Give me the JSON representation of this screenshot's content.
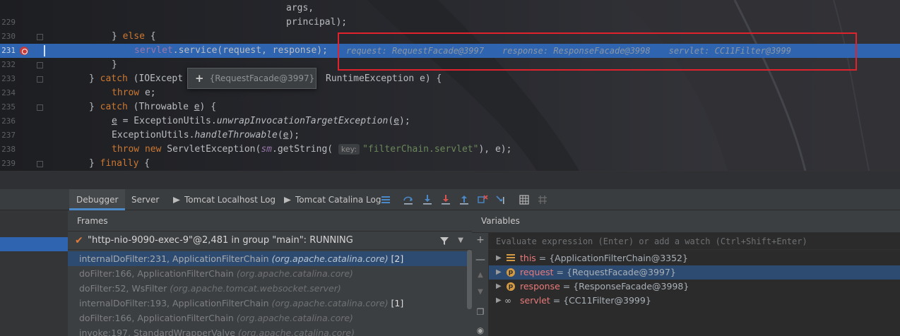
{
  "editor": {
    "lines": [
      {
        "num": "",
        "parts": [
          {
            "t": "args,",
            "c": ""
          }
        ]
      },
      {
        "num": "229",
        "parts": [
          {
            "t": "principal);",
            "c": ""
          }
        ]
      },
      {
        "num": "230",
        "parts": [
          {
            "t": "} ",
            "c": ""
          },
          {
            "t": "else",
            "c": "kw"
          },
          {
            "t": " {",
            "c": ""
          }
        ]
      },
      {
        "num": "231",
        "parts": [
          {
            "t": "servlet",
            "c": "fld"
          },
          {
            "t": ".service(request, response);",
            "c": ""
          }
        ]
      },
      {
        "num": "232",
        "parts": [
          {
            "t": "}",
            "c": ""
          }
        ]
      },
      {
        "num": "233",
        "parts": [
          {
            "t": "} ",
            "c": ""
          },
          {
            "t": "catch",
            "c": "kw"
          },
          {
            "t": " (IOExcept",
            "c": ""
          }
        ]
      },
      {
        "num": "234",
        "parts": [
          {
            "t": "throw",
            "c": "kw"
          },
          {
            "t": " e;",
            "c": ""
          }
        ]
      },
      {
        "num": "235",
        "parts": [
          {
            "t": "} ",
            "c": ""
          },
          {
            "t": "catch",
            "c": "kw"
          },
          {
            "t": " (Throwable ",
            "c": ""
          },
          {
            "t": "e",
            "c": "ul"
          },
          {
            "t": ") {",
            "c": ""
          }
        ]
      },
      {
        "num": "236",
        "parts": [
          {
            "t": "e",
            "c": "ul"
          },
          {
            "t": " = ExceptionUtils.",
            "c": ""
          },
          {
            "t": "unwrapInvocationTargetException",
            "c": "it"
          },
          {
            "t": "(",
            "c": ""
          },
          {
            "t": "e",
            "c": "ul"
          },
          {
            "t": ");",
            "c": ""
          }
        ]
      },
      {
        "num": "237",
        "parts": [
          {
            "t": "ExceptionUtils.",
            "c": ""
          },
          {
            "t": "handleThrowable",
            "c": "it"
          },
          {
            "t": "(",
            "c": ""
          },
          {
            "t": "e",
            "c": "ul"
          },
          {
            "t": ");",
            "c": ""
          }
        ]
      },
      {
        "num": "238",
        "parts": [
          {
            "t": "throw",
            "c": "kw"
          },
          {
            "t": " ",
            "c": ""
          },
          {
            "t": "new",
            "c": "kw"
          },
          {
            "t": " ServletException(",
            "c": ""
          },
          {
            "t": "sm",
            "c": "fld it"
          },
          {
            "t": ".getString(",
            "c": ""
          }
        ]
      },
      {
        "num": "239",
        "parts": [
          {
            "t": "} ",
            "c": ""
          },
          {
            "t": "finally",
            "c": "kw"
          },
          {
            "t": " {",
            "c": ""
          }
        ]
      }
    ],
    "line233_tail": "RuntimeException e) {",
    "line238_key_hint": "key:",
    "line238_tail_str": "\"filterChain.servlet\"",
    "line238_tail": "), e);",
    "inline_values": {
      "request": "request: RequestFacade@3997",
      "response": "response: ResponseFacade@3998",
      "servlet": "servlet: CC11Filter@3999"
    },
    "popup": {
      "plus": "+",
      "value": "{RequestFacade@3997}"
    }
  },
  "tabs": [
    {
      "label": "Debugger",
      "active": true
    },
    {
      "label": "Server",
      "active": false
    },
    {
      "label": "Tomcat Localhost Log",
      "active": false,
      "icon": "terminal-icon"
    },
    {
      "label": "Tomcat Catalina Log",
      "active": false,
      "icon": "terminal-icon"
    }
  ],
  "frames": {
    "title": "Frames",
    "thread": "\"http-nio-9090-exec-9\"@2,481 in group \"main\": RUNNING",
    "items": [
      {
        "method": "internalDoFilter:231, ApplicationFilterChain ",
        "pkg": "(org.apache.catalina.core)",
        "count": " [2]",
        "selected": true
      },
      {
        "method": "doFilter:166, ApplicationFilterChain ",
        "pkg": "(org.apache.catalina.core)",
        "count": ""
      },
      {
        "method": "doFilter:52, WsFilter ",
        "pkg": "(org.apache.tomcat.websocket.server)",
        "count": ""
      },
      {
        "method": "internalDoFilter:193, ApplicationFilterChain ",
        "pkg": "(org.apache.catalina.core)",
        "count": " [1]"
      },
      {
        "method": "doFilter:166, ApplicationFilterChain ",
        "pkg": "(org.apache.catalina.core)",
        "count": ""
      },
      {
        "method": "invoke:197, StandardWrapperValve ",
        "pkg": "(org.apache.catalina.core)",
        "count": ""
      }
    ]
  },
  "variables": {
    "title": "Variables",
    "eval_placeholder": "Evaluate expression (Enter) or add a watch (Ctrl+Shift+Enter)",
    "items": [
      {
        "name": "this",
        "value": " = {ApplicationFilterChain@3352}",
        "icon": "field-lines-icon"
      },
      {
        "name": "request",
        "value": " = {RequestFacade@3997}",
        "icon": "parameter-icon",
        "selected": true
      },
      {
        "name": "response",
        "value": " = {ResponseFacade@3998}",
        "icon": "parameter-icon"
      },
      {
        "name": "servlet",
        "value": " = {CC11Filter@3999}",
        "icon": "watch-glasses-icon"
      }
    ],
    "param_icon_letter": "p"
  },
  "colors": {
    "accent": "#2f65b0",
    "highlight_box": "#e0222c",
    "keyword": "#cc7832"
  }
}
